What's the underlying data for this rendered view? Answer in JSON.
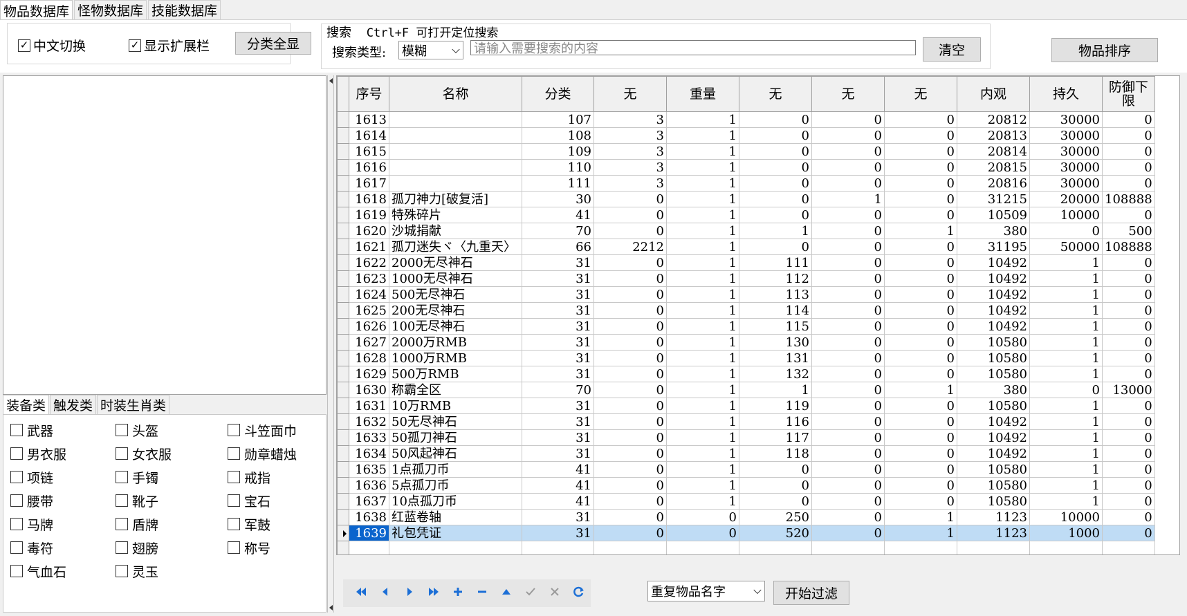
{
  "tabs": [
    {
      "label": "物品数据库",
      "active": true
    },
    {
      "label": "怪物数据库",
      "active": false
    },
    {
      "label": "技能数据库",
      "active": false
    }
  ],
  "toolbar": {
    "chinese_toggle": {
      "label": "中文切换",
      "checked": true
    },
    "show_ext": {
      "label": "显示扩展栏",
      "checked": true
    },
    "show_all_label": "分类全显",
    "search_title": "搜索",
    "search_hint": "Ctrl+F 可打开定位搜索",
    "search_type_label": "搜索类型:",
    "search_type_value": "模糊",
    "search_placeholder": "请输入需要搜索的内容",
    "clear_label": "清空",
    "sort_label": "物品排序"
  },
  "categories": {
    "tabs": [
      {
        "label": "装备类",
        "active": true
      },
      {
        "label": "触发类",
        "active": false
      },
      {
        "label": "时装生肖类",
        "active": false
      }
    ],
    "items": [
      {
        "label": "武器",
        "checked": false
      },
      {
        "label": "头盔",
        "checked": false
      },
      {
        "label": "斗笠面巾",
        "checked": false
      },
      {
        "label": "男衣服",
        "checked": false
      },
      {
        "label": "女衣服",
        "checked": false
      },
      {
        "label": "勋章蜡烛",
        "checked": false
      },
      {
        "label": "项链",
        "checked": false
      },
      {
        "label": "手镯",
        "checked": false
      },
      {
        "label": "戒指",
        "checked": false
      },
      {
        "label": "腰带",
        "checked": false
      },
      {
        "label": "靴子",
        "checked": false
      },
      {
        "label": "宝石",
        "checked": false
      },
      {
        "label": "马牌",
        "checked": false
      },
      {
        "label": "盾牌",
        "checked": false
      },
      {
        "label": "军鼓",
        "checked": false
      },
      {
        "label": "毒符",
        "checked": false
      },
      {
        "label": "翅膀",
        "checked": false
      },
      {
        "label": "称号",
        "checked": false
      },
      {
        "label": "气血石",
        "checked": false
      },
      {
        "label": "灵玉",
        "checked": false
      }
    ]
  },
  "grid": {
    "columns": [
      "序号",
      "名称",
      "分类",
      "无",
      "重量",
      "无",
      "无",
      "无",
      "内观",
      "持久",
      "防御下限"
    ],
    "selected_row": 26,
    "rows": [
      [
        "1613",
        "",
        "107",
        "3",
        "1",
        "0",
        "0",
        "0",
        "20812",
        "30000",
        "0"
      ],
      [
        "1614",
        "",
        "108",
        "3",
        "1",
        "0",
        "0",
        "0",
        "20813",
        "30000",
        "0"
      ],
      [
        "1615",
        "",
        "109",
        "3",
        "1",
        "0",
        "0",
        "0",
        "20814",
        "30000",
        "0"
      ],
      [
        "1616",
        "",
        "110",
        "3",
        "1",
        "0",
        "0",
        "0",
        "20815",
        "30000",
        "0"
      ],
      [
        "1617",
        "",
        "111",
        "3",
        "1",
        "0",
        "0",
        "0",
        "20816",
        "30000",
        "0"
      ],
      [
        "1618",
        "孤刀神力[破复活]",
        "30",
        "0",
        "1",
        "0",
        "1",
        "0",
        "31215",
        "20000",
        "108888"
      ],
      [
        "1619",
        "特殊碎片",
        "41",
        "0",
        "1",
        "0",
        "0",
        "0",
        "10509",
        "10000",
        "0"
      ],
      [
        "1620",
        "沙城捐献",
        "70",
        "0",
        "1",
        "1",
        "0",
        "1",
        "380",
        "0",
        "500"
      ],
      [
        "1621",
        "孤刀迷失ヾ〈九重天〉",
        "66",
        "2212",
        "1",
        "0",
        "0",
        "0",
        "31195",
        "50000",
        "108888"
      ],
      [
        "1622",
        "2000无尽神石",
        "31",
        "0",
        "1",
        "111",
        "0",
        "0",
        "10492",
        "1",
        "0"
      ],
      [
        "1623",
        "1000无尽神石",
        "31",
        "0",
        "1",
        "112",
        "0",
        "0",
        "10492",
        "1",
        "0"
      ],
      [
        "1624",
        "500无尽神石",
        "31",
        "0",
        "1",
        "113",
        "0",
        "0",
        "10492",
        "1",
        "0"
      ],
      [
        "1625",
        "200无尽神石",
        "31",
        "0",
        "1",
        "114",
        "0",
        "0",
        "10492",
        "1",
        "0"
      ],
      [
        "1626",
        "100无尽神石",
        "31",
        "0",
        "1",
        "115",
        "0",
        "0",
        "10492",
        "1",
        "0"
      ],
      [
        "1627",
        "2000万RMB",
        "31",
        "0",
        "1",
        "130",
        "0",
        "0",
        "10580",
        "1",
        "0"
      ],
      [
        "1628",
        "1000万RMB",
        "31",
        "0",
        "1",
        "131",
        "0",
        "0",
        "10580",
        "1",
        "0"
      ],
      [
        "1629",
        "500万RMB",
        "31",
        "0",
        "1",
        "132",
        "0",
        "0",
        "10580",
        "1",
        "0"
      ],
      [
        "1630",
        "称霸全区",
        "70",
        "0",
        "1",
        "1",
        "0",
        "1",
        "380",
        "0",
        "13000"
      ],
      [
        "1631",
        "10万RMB",
        "31",
        "0",
        "1",
        "119",
        "0",
        "0",
        "10580",
        "1",
        "0"
      ],
      [
        "1632",
        "50无尽神石",
        "31",
        "0",
        "1",
        "116",
        "0",
        "0",
        "10492",
        "1",
        "0"
      ],
      [
        "1633",
        "50孤刀神石",
        "31",
        "0",
        "1",
        "117",
        "0",
        "0",
        "10492",
        "1",
        "0"
      ],
      [
        "1634",
        "50风起神石",
        "31",
        "0",
        "1",
        "118",
        "0",
        "0",
        "10492",
        "1",
        "0"
      ],
      [
        "1635",
        "1点孤刀币",
        "41",
        "0",
        "1",
        "0",
        "0",
        "0",
        "10580",
        "1",
        "0"
      ],
      [
        "1636",
        "5点孤刀币",
        "41",
        "0",
        "1",
        "0",
        "0",
        "0",
        "10580",
        "1",
        "0"
      ],
      [
        "1637",
        "10点孤刀币",
        "41",
        "0",
        "1",
        "0",
        "0",
        "0",
        "10580",
        "1",
        "0"
      ],
      [
        "1638",
        "红蓝卷轴",
        "31",
        "0",
        "0",
        "250",
        "0",
        "1",
        "1123",
        "10000",
        "0"
      ],
      [
        "1639",
        "礼包凭证",
        "31",
        "0",
        "0",
        "520",
        "0",
        "1",
        "1123",
        "1000",
        "0"
      ]
    ]
  },
  "navigator": {
    "buttons": [
      {
        "name": "first-record",
        "icon": "double-left-arrow"
      },
      {
        "name": "prior-record",
        "icon": "left-arrow"
      },
      {
        "name": "next-record",
        "icon": "right-arrow"
      },
      {
        "name": "last-record",
        "icon": "double-right-arrow"
      },
      {
        "name": "insert-record",
        "icon": "plus"
      },
      {
        "name": "delete-record",
        "icon": "minus"
      },
      {
        "name": "edit-record",
        "icon": "up-arrow"
      },
      {
        "name": "post-record",
        "icon": "check"
      },
      {
        "name": "cancel-record",
        "icon": "cross"
      },
      {
        "name": "refresh-records",
        "icon": "refresh"
      }
    ]
  },
  "filter": {
    "select_value": "重复物品名字",
    "start_label": "开始过滤"
  },
  "colors": {
    "selected_row": "#bfdcf5",
    "selected_cell": "#0a64cd",
    "nav_blue": "#1c6fd6"
  }
}
